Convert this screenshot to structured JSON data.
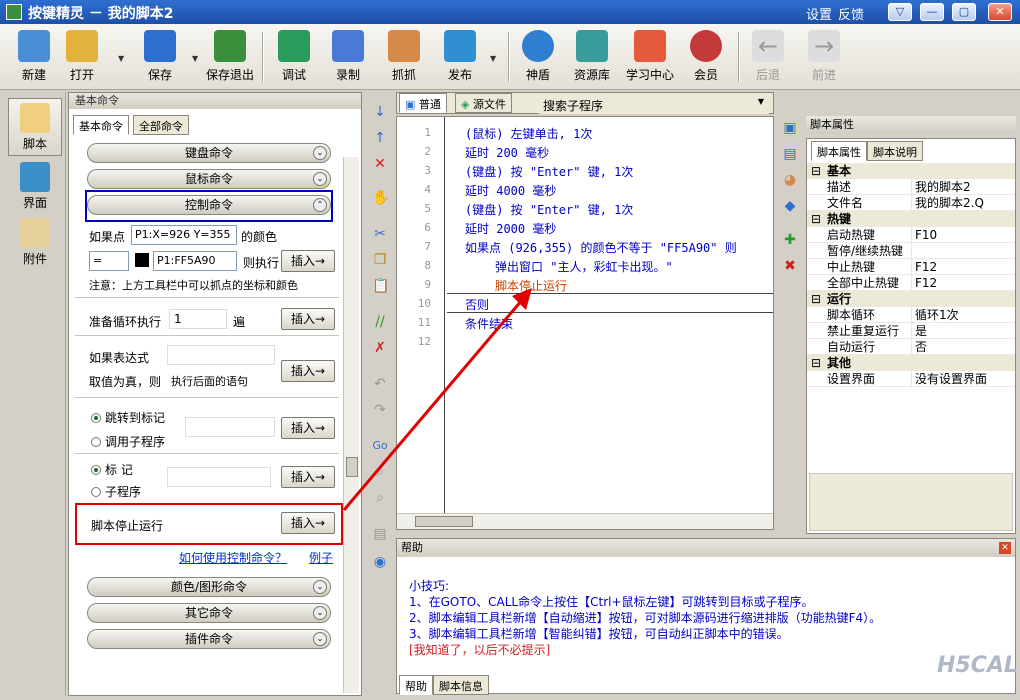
{
  "window": {
    "title": "按键精灵 － 我的脚本2",
    "links": [
      "设置",
      "反馈"
    ],
    "controls": [
      "▽",
      "—",
      "▢",
      "✕"
    ]
  },
  "toolbar": {
    "buttons": [
      {
        "label": "新建",
        "icon": "new-file-icon",
        "color": "#4a8fd6"
      },
      {
        "label": "打开",
        "icon": "open-folder-icon",
        "color": "#e3b23c"
      },
      {
        "label": "保存",
        "icon": "save-disk-icon",
        "color": "#2f6fd0"
      },
      {
        "label": "保存退出",
        "icon": "save-exit-icon",
        "color": "#3a8f3a"
      },
      {
        "label": "调试",
        "icon": "debug-icon",
        "color": "#2a9b5a"
      },
      {
        "label": "录制",
        "icon": "record-camera-icon",
        "color": "#4a7ad6"
      },
      {
        "label": "抓抓",
        "icon": "grab-hand-icon",
        "color": "#d68a4a"
      },
      {
        "label": "发布",
        "icon": "publish-globe-icon",
        "color": "#2f8fd0"
      },
      {
        "label": "神盾",
        "icon": "shield-icon",
        "color": "#2f7fd0"
      },
      {
        "label": "资源库",
        "icon": "library-icon",
        "color": "#3a9b9b"
      },
      {
        "label": "学习中心",
        "icon": "learning-center-icon",
        "color": "#e35a3c"
      },
      {
        "label": "会员",
        "icon": "member-icon",
        "color": "#c43a3a"
      },
      {
        "label": "后退",
        "icon": "back-arrow-icon",
        "color": "#bbbbbb"
      },
      {
        "label": "前进",
        "icon": "forward-arrow-icon",
        "color": "#bbbbbb"
      }
    ]
  },
  "leftbar": {
    "items": [
      {
        "label": "脚本",
        "icon": "script-icon",
        "active": true
      },
      {
        "label": "界面",
        "icon": "interface-icon",
        "active": false
      },
      {
        "label": "附件",
        "icon": "attachment-icon",
        "active": false
      }
    ]
  },
  "commands": {
    "panel_title": "基本命令",
    "tabs": [
      "基本命令",
      "全部命令"
    ],
    "categories": [
      "键盘命令",
      "鼠标命令",
      "控制命令"
    ],
    "if_point": {
      "label": "如果点",
      "point_value": "P1:X=926 Y=355",
      "color_label": "的颜色",
      "op_value": "=",
      "color_value": "P1:FF5A90",
      "then_label": "则执行",
      "note": "注意：上方工具栏中可以抓点的坐标和颜色"
    },
    "loop": {
      "label": "准备循环执行",
      "value": "1",
      "unit": "遍"
    },
    "expr": {
      "label": "如果表达式",
      "true_label": "取值为真，则",
      "action_value": "执行后面的语句"
    },
    "jump": {
      "opt1": "跳转到标记",
      "opt2": "调用子程序"
    },
    "mark": {
      "opt1": "标 记",
      "opt2": "子程序"
    },
    "stop": {
      "label": "脚本停止运行"
    },
    "insert_label": "插入→",
    "help_link": "如何使用控制命令？",
    "example_link": "例子",
    "bottom_categories": [
      "颜色/图形命令",
      "其它命令",
      "插件命令"
    ]
  },
  "editor": {
    "tabs": [
      "普通",
      "源文件"
    ],
    "subroutine_placeholder": "搜索子程序",
    "lines": [
      {
        "n": "1",
        "text": "(鼠标) 左键单击, 1次",
        "color": "blue",
        "indent": 0
      },
      {
        "n": "2",
        "text": "延时 200 毫秒",
        "color": "blue",
        "indent": 0
      },
      {
        "n": "3",
        "text": "(键盘) 按 \"Enter\" 键, 1次",
        "color": "blue",
        "indent": 0
      },
      {
        "n": "4",
        "text": "延时 4000 毫秒",
        "color": "blue",
        "indent": 0
      },
      {
        "n": "5",
        "text": "(键盘) 按 \"Enter\" 键, 1次",
        "color": "blue",
        "indent": 0
      },
      {
        "n": "6",
        "text": "延时 2000 毫秒",
        "color": "blue",
        "indent": 0
      },
      {
        "n": "7",
        "text": "如果点 (926,355) 的颜色不等于 \"FF5A90\" 则",
        "color": "blue",
        "indent": 0
      },
      {
        "n": "8",
        "text": "弹出窗口 \"主人，彩虹卡出现。\"",
        "color": "blue",
        "indent": 1
      },
      {
        "n": "9",
        "text": "脚本停止运行",
        "color": "red",
        "indent": 1
      },
      {
        "n": "10",
        "text": "否则",
        "color": "blue",
        "indent": 0
      },
      {
        "n": "11",
        "text": "条件结束",
        "color": "blue",
        "indent": 0
      },
      {
        "n": "12",
        "text": "",
        "color": "blue",
        "indent": 0
      }
    ]
  },
  "properties": {
    "panel_title": "脚本属性",
    "tabs": [
      "脚本属性",
      "脚本说明"
    ],
    "groups": [
      {
        "name": "基本",
        "rows": [
          {
            "k": "描述",
            "v": "我的脚本2"
          },
          {
            "k": "文件名",
            "v": "我的脚本2.Q"
          }
        ]
      },
      {
        "name": "热键",
        "rows": [
          {
            "k": "启动热键",
            "v": "F10"
          },
          {
            "k": "暂停/继续热键",
            "v": ""
          },
          {
            "k": "中止热键",
            "v": "F12"
          },
          {
            "k": "全部中止热键",
            "v": "F12"
          }
        ]
      },
      {
        "name": "运行",
        "rows": [
          {
            "k": "脚本循环",
            "v": "循环1次"
          },
          {
            "k": "禁止重复运行",
            "v": "是"
          },
          {
            "k": "自动运行",
            "v": "否"
          }
        ]
      },
      {
        "name": "其他",
        "rows": [
          {
            "k": "设置界面",
            "v": "没有设置界面"
          }
        ]
      }
    ]
  },
  "help": {
    "title": "帮助",
    "tip_title": "小技巧:",
    "tips": [
      "1、在GOTO、CALL命令上按住【Ctrl+鼠标左键】可跳转到目标或子程序。",
      "2、脚本编辑工具栏新增【自动缩进】按钮，可对脚本源码进行缩进排版（功能热键F4）。",
      "3、脚本编辑工具栏新增【智能纠错】按钮，可自动纠正脚本中的错误。"
    ],
    "dismiss": "[我知道了，以后不必提示]",
    "tabs": [
      "帮助",
      "脚本信息"
    ],
    "watermark": "H5CAL"
  },
  "colors": {
    "accent": "#2f6fd0",
    "annotation_red": "#e00000",
    "annotation_blue": "#0000c8",
    "code_blue": "#0000c8",
    "code_red": "#c84200"
  }
}
